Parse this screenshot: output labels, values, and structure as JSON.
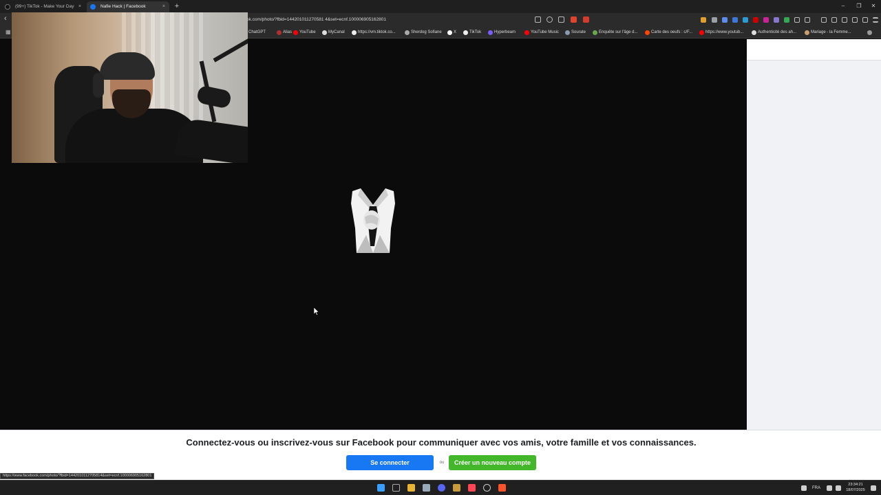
{
  "browser": {
    "tabs": [
      {
        "title": "(99+) TikTok - Make Your Day",
        "favicon": "tiktok-icon",
        "active": false
      },
      {
        "title": "Nafie Hack | Facebook",
        "favicon": "facebook-icon",
        "active": true
      }
    ],
    "url": "ok.com/photo/?fbid=144201011270581 4&set=ecnf.100006905162801",
    "bookmarks": [
      {
        "label": "ChatGPT",
        "icon": "chatgpt-icon",
        "color": "#bcbcbc"
      },
      {
        "label": "Alias",
        "icon": "alias-icon",
        "color": "#b03030"
      },
      {
        "label": "YouTube",
        "icon": "youtube-icon",
        "color": "#ff0000"
      },
      {
        "label": "MyCanal",
        "icon": "mycanal-icon",
        "color": "#dddddd"
      },
      {
        "label": "https://vm.tiktok.co...",
        "icon": "tiktok-icon",
        "color": "#eeeeee"
      },
      {
        "label": "Sherdog Sofiane",
        "icon": "sherdog-icon",
        "color": "#aaaaaa"
      },
      {
        "label": "X",
        "icon": "x-icon",
        "color": "#ffffff"
      },
      {
        "label": "TikTok",
        "icon": "tiktok-icon",
        "color": "#eeeeee"
      },
      {
        "label": "Hyperbeam",
        "icon": "hyperbeam-icon",
        "color": "#7b5cff"
      },
      {
        "label": "YouTube Music",
        "icon": "youtube-music-icon",
        "color": "#ff0000"
      },
      {
        "label": "Sourate",
        "icon": "sourate-icon",
        "color": "#8a9ab0"
      },
      {
        "label": "Enquête sur l'âge d...",
        "icon": "survey-icon",
        "color": "#6aa84f"
      },
      {
        "label": "Carte des oeufs : c/F...",
        "icon": "reddit-icon",
        "color": "#ff4500"
      },
      {
        "label": "https://www.youtub...",
        "icon": "youtube-icon",
        "color": "#ff0000"
      },
      {
        "label": "Authenticité des ah...",
        "icon": "globe-icon",
        "color": "#dddddd"
      },
      {
        "label": "Mariage - la Femme...",
        "icon": "page-icon",
        "color": "#c8a070"
      }
    ]
  },
  "page": {
    "banner_text": "Connectez-vous ou inscrivez-vous sur Facebook pour communiquer avec vos amis, votre famille et vos connaissances.",
    "login_label": "Se connecter",
    "separator": "ou",
    "signup_label": "Créer un nouveau compte",
    "status_url": "https://www.facebook.com/photo/?fbid=1442010112705814&set=ecnf.100006905162801",
    "colors": {
      "login": "#1877f2",
      "signup": "#42b72a"
    }
  },
  "taskbar": {
    "apps": [
      "windows-start-icon",
      "terminal-icon",
      "file-explorer-icon",
      "calculator-icon",
      "discord-icon",
      "league-icon",
      "valorant-icon",
      "chrome-icon",
      "brave-icon"
    ],
    "language": "FRA",
    "time": "23:34:21",
    "date": "18/07/2025"
  }
}
